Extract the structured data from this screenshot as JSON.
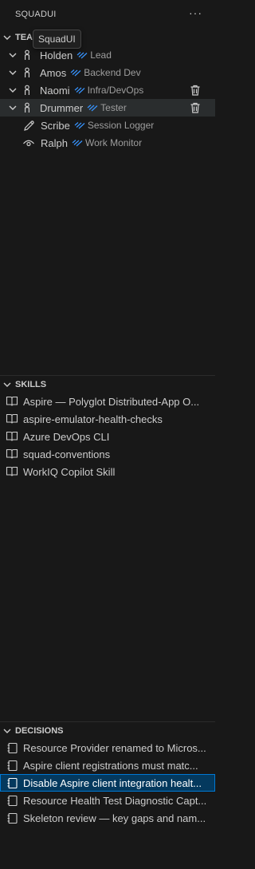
{
  "view": {
    "title": "SQUADUI",
    "more_label": "···",
    "tooltip": "SquadUI"
  },
  "team": {
    "header": "TEAM",
    "members": [
      {
        "name": "Holden",
        "role": "Lead"
      },
      {
        "name": "Amos",
        "role": "Backend Dev"
      },
      {
        "name": "Naomi",
        "role": "Infra/DevOps"
      },
      {
        "name": "Drummer",
        "role": "Tester"
      },
      {
        "name": "Scribe",
        "role": "Session Logger"
      },
      {
        "name": "Ralph",
        "role": "Work Monitor"
      }
    ]
  },
  "skills": {
    "header": "SKILLS",
    "items": [
      "Aspire — Polyglot Distributed-App O...",
      "aspire-emulator-health-checks",
      "Azure DevOps CLI",
      "squad-conventions",
      "WorkIQ Copilot Skill"
    ]
  },
  "decisions": {
    "header": "DECISIONS",
    "items": [
      "Resource Provider renamed to Micros...",
      "Aspire client registrations must matc...",
      "Disable Aspire client integration healt...",
      "Resource Health Test Diagnostic Capt...",
      "Skeleton review — key gaps and nam..."
    ]
  },
  "colors": {
    "background": "#181818",
    "selection": "#04395e",
    "focus": "#0078d4",
    "hover": "#2a2d2e"
  }
}
